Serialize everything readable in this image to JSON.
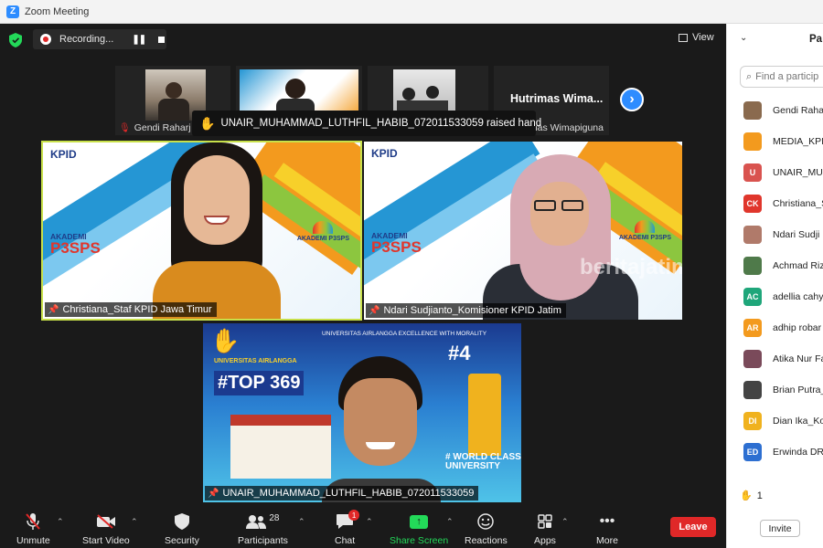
{
  "window": {
    "title": "Zoom Meeting"
  },
  "recording": {
    "label": "Recording..."
  },
  "view": {
    "label": "View"
  },
  "thumbnails": [
    {
      "name": "Gendi Raharj"
    },
    {
      "name": ""
    },
    {
      "name": ""
    },
    {
      "name": "Hutrimas Wimapiguna",
      "big_name": "Hutrimas  Wima..."
    }
  ],
  "raise_banner": {
    "text": "UNAIR_MUHAMMAD_LUTHFIL_HABIB_072011533059 raised hand"
  },
  "tiles": [
    {
      "name": "Christiana_Staf KPID Jawa Timur"
    },
    {
      "name": "Ndari Sudjianto_Komisioner KPID Jatim"
    },
    {
      "name": "UNAIR_MUHAMMAD_LUTHFIL_HABIB_072011533059"
    }
  ],
  "backdrop": {
    "kpid": "KPID",
    "akademi": "AKADEMI",
    "p3sps": "P3SPS",
    "side_logo": "AKADEMI P3SPS",
    "watermark": "beritajatim",
    "univ": "UNIVERSITAS AIRLANGGA EXCELLENCE WITH MORALITY",
    "top369_sub": "UNIVERSITAS AIRLANGGA",
    "top369": "#TOP 369",
    "rank": "#4",
    "wcu": "# WORLD CLASS UNIVERSITY"
  },
  "toolbar": {
    "unmute": "Unmute",
    "start_video": "Start Video",
    "security": "Security",
    "participants": "Participants",
    "participants_count": "28",
    "chat": "Chat",
    "chat_badge": "1",
    "share_screen": "Share Screen",
    "reactions": "Reactions",
    "apps": "Apps",
    "more": "More",
    "leave": "Leave"
  },
  "panel": {
    "title": "Pa",
    "search_placeholder": "Find a particip",
    "participants": [
      {
        "name": "Gendi Raha",
        "avatar_text": "",
        "color": "#8a6a4e"
      },
      {
        "name": "MEDIA_KPID",
        "avatar_text": "",
        "color": "#f39a1e"
      },
      {
        "name": "UNAIR_MU",
        "avatar_text": "U",
        "color": "#d9534f"
      },
      {
        "name": "Christiana_S",
        "avatar_text": "CK",
        "color": "#e0362c"
      },
      {
        "name": "Ndari Sudji",
        "avatar_text": "",
        "color": "#b07a6a"
      },
      {
        "name": "Achmad Riz",
        "avatar_text": "",
        "color": "#4f7a4a"
      },
      {
        "name": "adellia cahy",
        "avatar_text": "AC",
        "color": "#1fa67a"
      },
      {
        "name": "adhip robar",
        "avatar_text": "AR",
        "color": "#f39a1e"
      },
      {
        "name": "Atika Nur Fa",
        "avatar_text": "",
        "color": "#7a4a5a"
      },
      {
        "name": "Brian Putra_",
        "avatar_text": "",
        "color": "#444444"
      },
      {
        "name": "Dian Ika_Ko",
        "avatar_text": "DI",
        "color": "#f0b21e"
      },
      {
        "name": "Erwinda DR",
        "avatar_text": "ED",
        "color": "#2d6fd1"
      }
    ],
    "raised_count": "1",
    "invite": "Invite"
  }
}
